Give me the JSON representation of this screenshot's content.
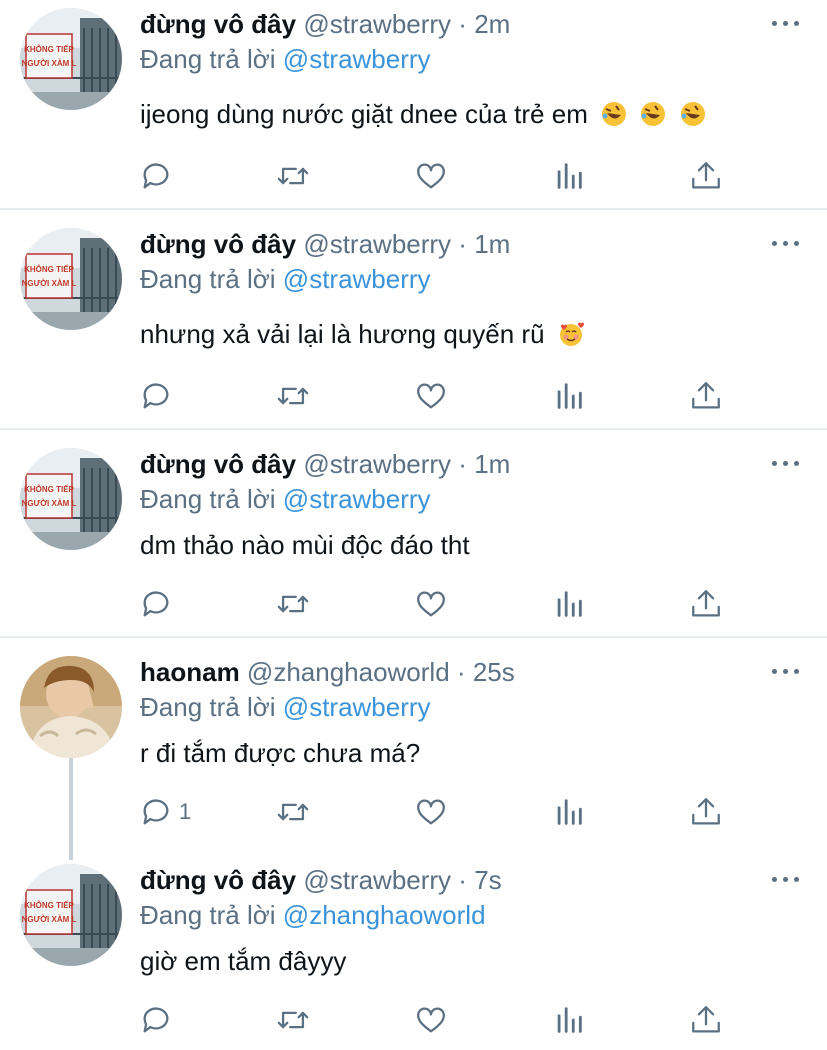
{
  "tweets": [
    {
      "name": "đừng vô đây",
      "handle": "@strawberry",
      "sep": "·",
      "time": "2m",
      "reply_prefix": "Đang trả lời",
      "reply_to": "@strawberry",
      "text": "ijeong dùng nước giặt dnee của trẻ em",
      "emojis": [
        "rofl-emoji",
        "rofl-emoji",
        "rofl-emoji"
      ],
      "avatar": "sign-photo",
      "reply_count": ""
    },
    {
      "name": "đừng vô đây",
      "handle": "@strawberry",
      "sep": "·",
      "time": "1m",
      "reply_prefix": "Đang trả lời",
      "reply_to": "@strawberry",
      "text": "nhưng xả vải lại là hương quyến rũ",
      "emojis": [
        "smiling-face-with-hearts-emoji"
      ],
      "avatar": "sign-photo",
      "reply_count": ""
    },
    {
      "name": "đừng vô đây",
      "handle": "@strawberry",
      "sep": "·",
      "time": "1m",
      "reply_prefix": "Đang trả lời",
      "reply_to": "@strawberry",
      "text": "dm thảo nào mùi độc đáo tht",
      "emojis": [],
      "avatar": "sign-photo",
      "reply_count": ""
    },
    {
      "name": "haonam",
      "handle": "@zhanghaoworld",
      "sep": "·",
      "time": "25s",
      "reply_prefix": "Đang trả lời",
      "reply_to": "@strawberry",
      "text": "r đi tắm được chưa má?",
      "emojis": [],
      "avatar": "person-photo",
      "reply_count": "1"
    },
    {
      "name": "đừng vô đây",
      "handle": "@strawberry",
      "sep": "·",
      "time": "7s",
      "reply_prefix": "Đang trả lời",
      "reply_to": "@zhanghaoworld",
      "text": "giờ em tắm đâyyy",
      "emojis": [],
      "avatar": "sign-photo",
      "reply_count": ""
    }
  ],
  "icons": {
    "reply": "reply-icon",
    "retweet": "retweet-icon",
    "like": "like-icon",
    "analytics": "analytics-icon",
    "share": "share-icon",
    "more": "more-icon"
  },
  "colors": {
    "text": "#0f1419",
    "secondary": "#5b7083",
    "mention": "#3b94d9",
    "divider": "#e6ecf0",
    "thread_line": "#c8d1d8"
  }
}
